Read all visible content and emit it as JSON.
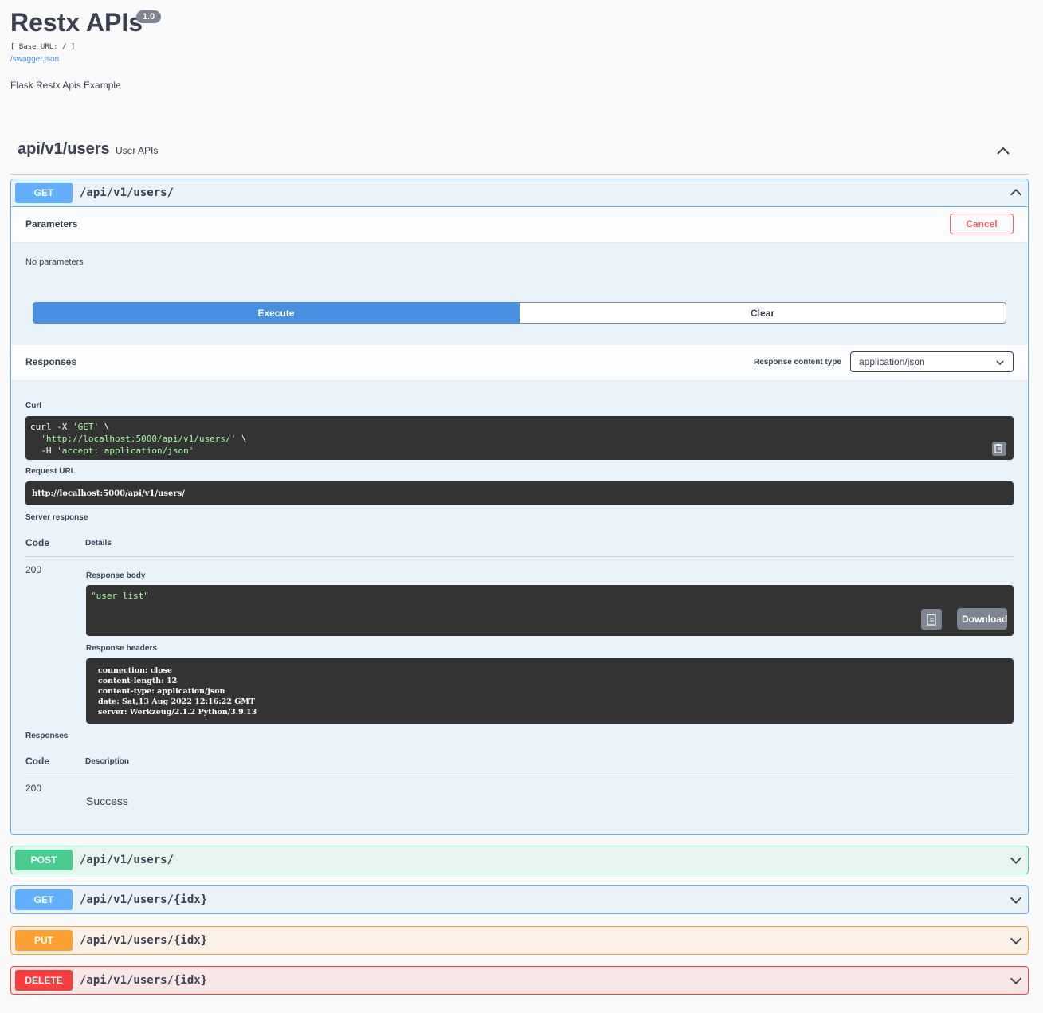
{
  "info": {
    "title": "Restx APIs",
    "version": "1.0",
    "base_url": "[ Base URL: / ]",
    "spec_link": "/swagger.json",
    "description": "Flask Restx Apis Example"
  },
  "tag": {
    "name": "api/v1/users",
    "description": "User APIs",
    "toggle_icon": "chevron-up-icon"
  },
  "expanded_operation": {
    "method": "GET",
    "path": "/api/v1/users/",
    "parameters": {
      "heading": "Parameters",
      "cancel_label": "Cancel",
      "empty_text": "No parameters"
    },
    "execute_label": "Execute",
    "clear_label": "Clear",
    "responses": {
      "heading": "Responses",
      "content_type_label": "Response content type",
      "content_type_value": "application/json"
    },
    "curl": {
      "label": "Curl",
      "line1_cmd": "curl -X ",
      "line1_str": "'GET'",
      "line1_tail": " \\",
      "line2_str": "'http://localhost:5000/api/v1/users/'",
      "line2_tail": " \\",
      "line3_cmd": "-H ",
      "line3_str": "'accept: application/json'"
    },
    "request_url": {
      "label": "Request URL",
      "value": "http://localhost:5000/api/v1/users/"
    },
    "server_response": {
      "label": "Server response",
      "col_code": "Code",
      "col_details": "Details",
      "code": "200",
      "body_label": "Response body",
      "body": "\"user list\"",
      "download_label": "Download",
      "headers_label": "Response headers",
      "headers": [
        "connection: close",
        "content-length: 12",
        "content-type: application/json",
        "date: Sat,13 Aug 2022 12:16:22 GMT",
        "server: Werkzeug/2.1.2 Python/3.9.13"
      ]
    },
    "documented_responses": {
      "label": "Responses",
      "col_code": "Code",
      "col_description": "Description",
      "code": "200",
      "description": "Success"
    }
  },
  "collapsed_operations": [
    {
      "method": "POST",
      "path": "/api/v1/users/"
    },
    {
      "method": "GET",
      "path": "/api/v1/users/{idx}"
    },
    {
      "method": "PUT",
      "path": "/api/v1/users/{idx}"
    },
    {
      "method": "DELETE",
      "path": "/api/v1/users/{idx}"
    }
  ],
  "colors": {
    "get": "#61affe",
    "post": "#49cc90",
    "put": "#fca130",
    "delete": "#f93e3e",
    "execute": "#4990e2",
    "cancel": "#ff6060"
  }
}
